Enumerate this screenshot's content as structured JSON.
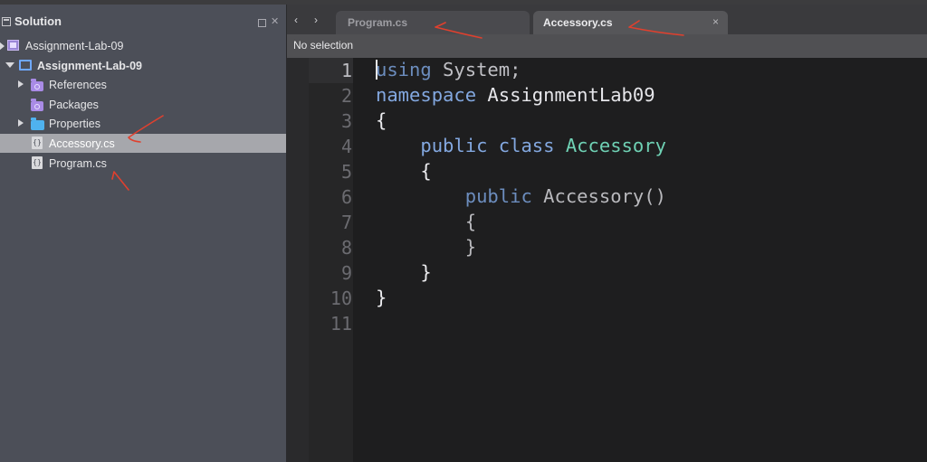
{
  "sidebar": {
    "title": "Solution",
    "items": [
      {
        "label": "Assignment-Lab-09",
        "icon": "solution-icon"
      },
      {
        "label": "Assignment-Lab-09",
        "icon": "project-icon"
      },
      {
        "label": "References",
        "icon": "references-folder-icon"
      },
      {
        "label": "Packages",
        "icon": "packages-folder-icon"
      },
      {
        "label": "Properties",
        "icon": "folder-icon"
      },
      {
        "label": "Accessory.cs",
        "icon": "csharp-file-icon",
        "selected": true
      },
      {
        "label": "Program.cs",
        "icon": "csharp-file-icon"
      }
    ],
    "pin_icon": "pin-icon",
    "close_icon": "close-icon"
  },
  "editor": {
    "nav_back": "‹",
    "nav_forward": "›",
    "tabs": [
      {
        "label": "Program.cs",
        "active": false
      },
      {
        "label": "Accessory.cs",
        "active": true,
        "close": "×"
      }
    ],
    "info": "No selection",
    "line_numbers": [
      "1",
      "2",
      "3",
      "4",
      "5",
      "6",
      "7",
      "8",
      "9",
      "10",
      "11"
    ],
    "code": {
      "l1_kw": "using",
      "l1_rest": " System;",
      "l2_kw": "namespace",
      "l2_rest": " AssignmentLab09",
      "l3": "{",
      "l4_kw1": "public",
      "l4_kw2": "class",
      "l4_cls": "Accessory",
      "l5": "{",
      "l6_kw": "public",
      "l6_rest": " Accessory()",
      "l7": "{",
      "l8": "}",
      "l9": "}",
      "l10": "}"
    }
  },
  "colors": {
    "sidebar_bg": "#4c4f58",
    "selected_row": "#a6a7ac",
    "editor_bg": "#1e1e1f",
    "keyword": "#83a8e0",
    "class_name": "#6fd1b4",
    "annotation": "#e0402e"
  }
}
